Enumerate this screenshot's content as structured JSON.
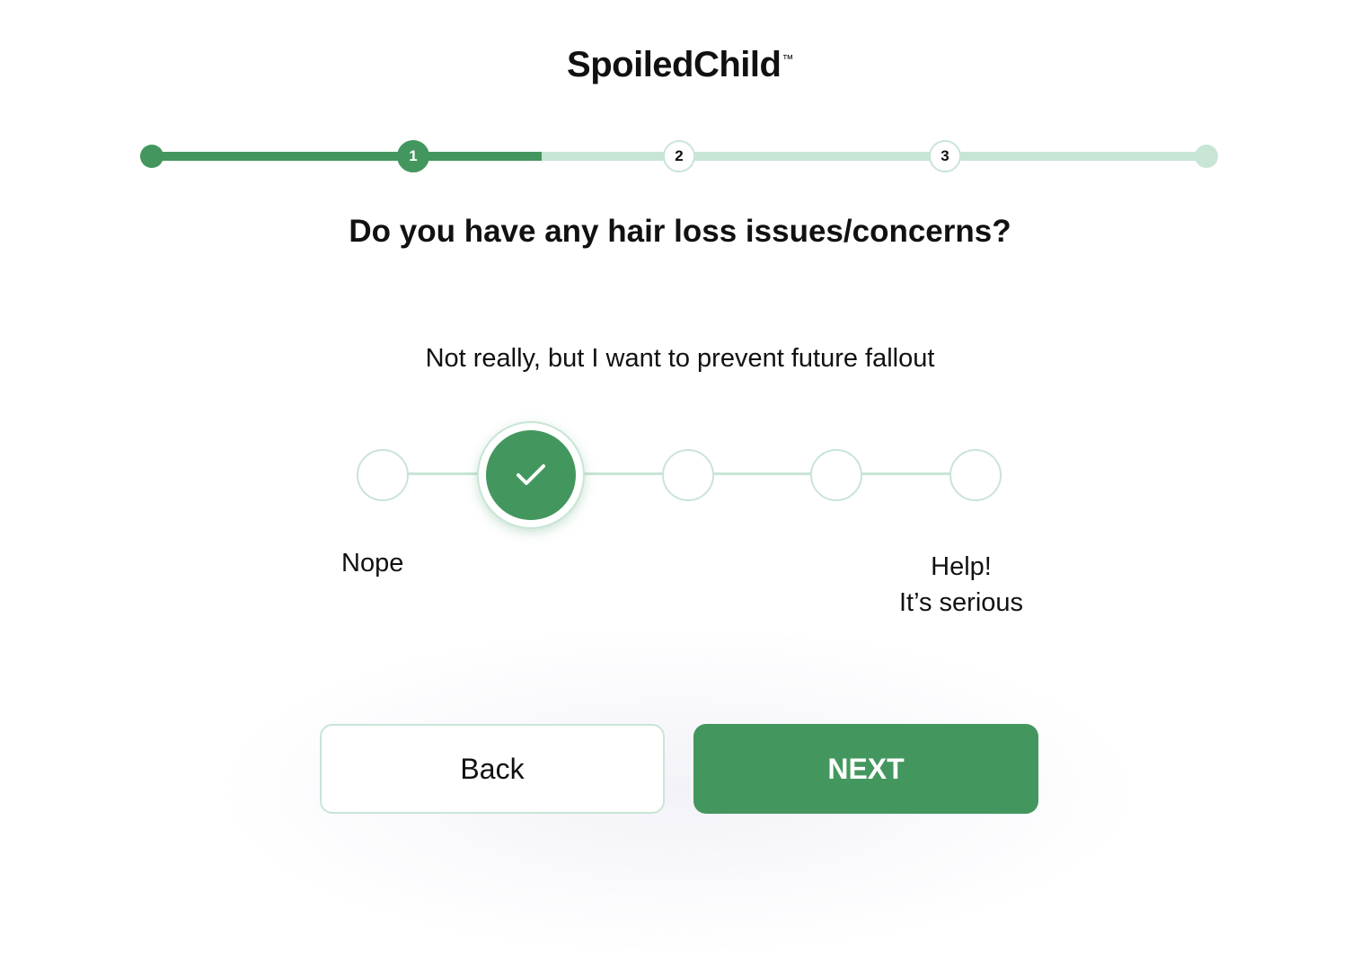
{
  "brand": {
    "name": "SpoiledChild",
    "trademark": "™"
  },
  "progress": {
    "fraction_complete": 0.37,
    "steps": [
      "1",
      "2",
      "3"
    ],
    "active_step": 1
  },
  "question": {
    "text": "Do you have any hair loss issues/concerns?",
    "selected_answer": "Not really, but I want to prevent future fallout"
  },
  "scale": {
    "option_count": 5,
    "selected_index": 1,
    "label_min": "Nope",
    "label_max_line1": "Help!",
    "label_max_line2": "It’s serious"
  },
  "buttons": {
    "back_label": "Back",
    "next_label": "NEXT"
  },
  "colors": {
    "accent": "#43975e",
    "accent_light": "#c8e5d6"
  }
}
